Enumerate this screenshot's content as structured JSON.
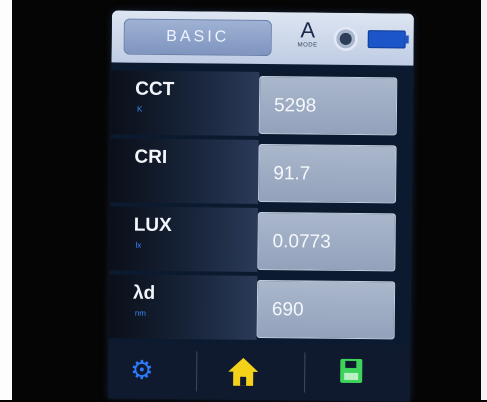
{
  "header": {
    "mode_tab": "BASIC",
    "measure_mode": "A",
    "measure_mode_sub": "MODE"
  },
  "rows": [
    {
      "name": "CCT",
      "unit": "K",
      "value": "5298"
    },
    {
      "name": "CRI",
      "unit": "",
      "value": "91.7"
    },
    {
      "name": "LUX",
      "unit": "lx",
      "value": "0.0773"
    },
    {
      "name": "λd",
      "unit": "nm",
      "value": "690"
    }
  ],
  "footer": {
    "icons": [
      "gear-icon",
      "home-icon",
      "save-icon"
    ]
  },
  "colors": {
    "accent_blue": "#2d7bff",
    "home_yellow": "#f5d21a",
    "save_green": "#3ed35a",
    "battery_blue": "#1b55c7"
  }
}
